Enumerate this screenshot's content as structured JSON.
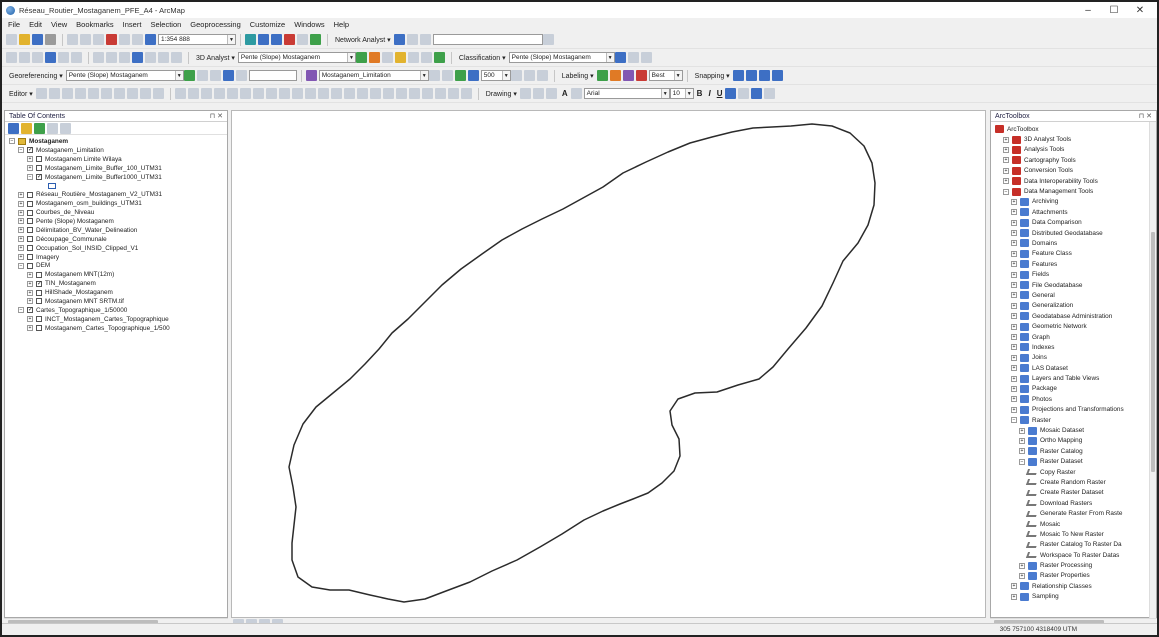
{
  "window": {
    "title": "Réseau_Routier_Mostaganem_PFE_A4 - ArcMap",
    "minimize": "–",
    "maximize": "☐",
    "close": "✕"
  },
  "menu": [
    "File",
    "Edit",
    "View",
    "Bookmarks",
    "Insert",
    "Selection",
    "Geoprocessing",
    "Customize",
    "Windows",
    "Help"
  ],
  "toolbar1": {
    "scale_value": "1:354 888",
    "network_analyst": "Network Analyst ▾"
  },
  "toolbar2": {
    "analyst_3d": "3D Analyst ▾",
    "layer_3d": "Pente (Slope) Mostaganem",
    "classification": "Classification ▾",
    "classification_layer": "Pente (Slope) Mostaganem"
  },
  "toolbar3": {
    "georeferencing": "Georeferencing ▾",
    "geo_layer": "Pente (Slope) Mostaganem",
    "layer_combo": "Mostaganem_Limitation",
    "value_500": "500",
    "labeling": "Labeling ▾",
    "best": "Best",
    "snapping": "Snapping ▾"
  },
  "toolbar4": {
    "editor": "Editor ▾",
    "drawing": "Drawing ▾",
    "font": "Arial",
    "font_size": "10",
    "bold": "B",
    "italic": "I",
    "underline": "U",
    "text_tool": "A"
  },
  "toc": {
    "header": "Table Of Contents",
    "pin": "⊓ ✕",
    "rows": [
      {
        "label": "Mostaganem",
        "level": 0,
        "exp": "−",
        "kind": "frame",
        "checked": null,
        "bold": true
      },
      {
        "label": "Mostaganem_Limitation",
        "level": 1,
        "exp": "−",
        "kind": "layer",
        "checked": true
      },
      {
        "label": "Mostaganem Limite Wilaya",
        "level": 2,
        "exp": "+",
        "kind": "layer",
        "checked": false
      },
      {
        "label": "Mostaganem_Limite_Buffer_100_UTM31",
        "level": 2,
        "exp": "+",
        "kind": "layer",
        "checked": false
      },
      {
        "label": "Mostaganem_Limite_Buffer1000_UTM31",
        "level": 2,
        "exp": "−",
        "kind": "layer",
        "checked": true
      },
      {
        "label": "",
        "level": 3,
        "exp": null,
        "kind": "swatch",
        "checked": null
      },
      {
        "label": "Réseau_Routière_Mostaganem_V2_UTM31",
        "level": 1,
        "exp": "+",
        "kind": "layer",
        "checked": false
      },
      {
        "label": "Mostaganem_osm_buildings_UTM31",
        "level": 1,
        "exp": "+",
        "kind": "layer",
        "checked": false
      },
      {
        "label": "Courbes_de_Niveau",
        "level": 1,
        "exp": "+",
        "kind": "layer",
        "checked": false
      },
      {
        "label": "Pente (Slope) Mostaganem",
        "level": 1,
        "exp": "+",
        "kind": "layer",
        "checked": false
      },
      {
        "label": "Délimitation_BV_Water_Delineation",
        "level": 1,
        "exp": "+",
        "kind": "layer",
        "checked": false
      },
      {
        "label": "Découpage_Communale",
        "level": 1,
        "exp": "+",
        "kind": "layer",
        "checked": false
      },
      {
        "label": "Occupation_Sol_INSID_Clipped_V1",
        "level": 1,
        "exp": "+",
        "kind": "layer",
        "checked": false
      },
      {
        "label": "Imagery",
        "level": 1,
        "exp": "+",
        "kind": "layer",
        "checked": false
      },
      {
        "label": "DEM",
        "level": 1,
        "exp": "−",
        "kind": "layer",
        "checked": false
      },
      {
        "label": "Mostaganem MNT(12m)",
        "level": 2,
        "exp": "+",
        "kind": "layer",
        "checked": false
      },
      {
        "label": "TIN_Mostaganem",
        "level": 2,
        "exp": "+",
        "kind": "layer",
        "checked": true
      },
      {
        "label": "HillShade_Mostaganem",
        "level": 2,
        "exp": "+",
        "kind": "layer",
        "checked": false
      },
      {
        "label": "Mostaganem MNT SRTM.tif",
        "level": 2,
        "exp": "+",
        "kind": "layer",
        "checked": false
      },
      {
        "label": "Cartes_Topographique_1/50000",
        "level": 1,
        "exp": "−",
        "kind": "layer",
        "checked": true
      },
      {
        "label": "INCT_Mostaganem_Cartes_Topographique",
        "level": 2,
        "exp": "+",
        "kind": "layer",
        "checked": false
      },
      {
        "label": "Mostaganem_Cartes_Topographique_1/500",
        "level": 2,
        "exp": "+",
        "kind": "layer",
        "checked": false
      }
    ]
  },
  "toolbox": {
    "header": "ArcToolbox",
    "pin": "⊓ ✕",
    "rows": [
      {
        "label": "ArcToolbox",
        "level": 0,
        "exp": null,
        "kind": "root"
      },
      {
        "label": "3D Analyst Tools",
        "level": 1,
        "exp": "+",
        "kind": "box"
      },
      {
        "label": "Analysis Tools",
        "level": 1,
        "exp": "+",
        "kind": "box"
      },
      {
        "label": "Cartography Tools",
        "level": 1,
        "exp": "+",
        "kind": "box"
      },
      {
        "label": "Conversion Tools",
        "level": 1,
        "exp": "+",
        "kind": "box"
      },
      {
        "label": "Data Interoperability Tools",
        "level": 1,
        "exp": "+",
        "kind": "box"
      },
      {
        "label": "Data Management Tools",
        "level": 1,
        "exp": "−",
        "kind": "box"
      },
      {
        "label": "Archiving",
        "level": 2,
        "exp": "+",
        "kind": "set"
      },
      {
        "label": "Attachments",
        "level": 2,
        "exp": "+",
        "kind": "set"
      },
      {
        "label": "Data Comparison",
        "level": 2,
        "exp": "+",
        "kind": "set"
      },
      {
        "label": "Distributed Geodatabase",
        "level": 2,
        "exp": "+",
        "kind": "set"
      },
      {
        "label": "Domains",
        "level": 2,
        "exp": "+",
        "kind": "set"
      },
      {
        "label": "Feature Class",
        "level": 2,
        "exp": "+",
        "kind": "set"
      },
      {
        "label": "Features",
        "level": 2,
        "exp": "+",
        "kind": "set"
      },
      {
        "label": "Fields",
        "level": 2,
        "exp": "+",
        "kind": "set"
      },
      {
        "label": "File Geodatabase",
        "level": 2,
        "exp": "+",
        "kind": "set"
      },
      {
        "label": "General",
        "level": 2,
        "exp": "+",
        "kind": "set"
      },
      {
        "label": "Generalization",
        "level": 2,
        "exp": "+",
        "kind": "set"
      },
      {
        "label": "Geodatabase Administration",
        "level": 2,
        "exp": "+",
        "kind": "set"
      },
      {
        "label": "Geometric Network",
        "level": 2,
        "exp": "+",
        "kind": "set"
      },
      {
        "label": "Graph",
        "level": 2,
        "exp": "+",
        "kind": "set"
      },
      {
        "label": "Indexes",
        "level": 2,
        "exp": "+",
        "kind": "set"
      },
      {
        "label": "Joins",
        "level": 2,
        "exp": "+",
        "kind": "set"
      },
      {
        "label": "LAS Dataset",
        "level": 2,
        "exp": "+",
        "kind": "set"
      },
      {
        "label": "Layers and Table Views",
        "level": 2,
        "exp": "+",
        "kind": "set"
      },
      {
        "label": "Package",
        "level": 2,
        "exp": "+",
        "kind": "set"
      },
      {
        "label": "Photos",
        "level": 2,
        "exp": "+",
        "kind": "set"
      },
      {
        "label": "Projections and Transformations",
        "level": 2,
        "exp": "+",
        "kind": "set"
      },
      {
        "label": "Raster",
        "level": 2,
        "exp": "−",
        "kind": "set"
      },
      {
        "label": "Mosaic Dataset",
        "level": 3,
        "exp": "+",
        "kind": "set"
      },
      {
        "label": "Ortho Mapping",
        "level": 3,
        "exp": "+",
        "kind": "set"
      },
      {
        "label": "Raster Catalog",
        "level": 3,
        "exp": "+",
        "kind": "set"
      },
      {
        "label": "Raster Dataset",
        "level": 3,
        "exp": "−",
        "kind": "set"
      },
      {
        "label": "Copy Raster",
        "level": 4,
        "exp": null,
        "kind": "tool"
      },
      {
        "label": "Create Random Raster",
        "level": 4,
        "exp": null,
        "kind": "tool"
      },
      {
        "label": "Create Raster Dataset",
        "level": 4,
        "exp": null,
        "kind": "tool"
      },
      {
        "label": "Download Rasters",
        "level": 4,
        "exp": null,
        "kind": "tool"
      },
      {
        "label": "Generate Raster From Raste",
        "level": 4,
        "exp": null,
        "kind": "tool"
      },
      {
        "label": "Mosaic",
        "level": 4,
        "exp": null,
        "kind": "tool"
      },
      {
        "label": "Mosaic To New Raster",
        "level": 4,
        "exp": null,
        "kind": "tool"
      },
      {
        "label": "Raster Catalog To Raster Da",
        "level": 4,
        "exp": null,
        "kind": "tool"
      },
      {
        "label": "Workspace To Raster Datas",
        "level": 4,
        "exp": null,
        "kind": "tool"
      },
      {
        "label": "Raster Processing",
        "level": 3,
        "exp": "+",
        "kind": "set"
      },
      {
        "label": "Raster Properties",
        "level": 3,
        "exp": "+",
        "kind": "set"
      },
      {
        "label": "Relationship Classes",
        "level": 2,
        "exp": "+",
        "kind": "set"
      },
      {
        "label": "Sampling",
        "level": 2,
        "exp": "+",
        "kind": "set"
      }
    ]
  },
  "statusbar": {
    "coords": "305 757100 4318409 UTM"
  }
}
